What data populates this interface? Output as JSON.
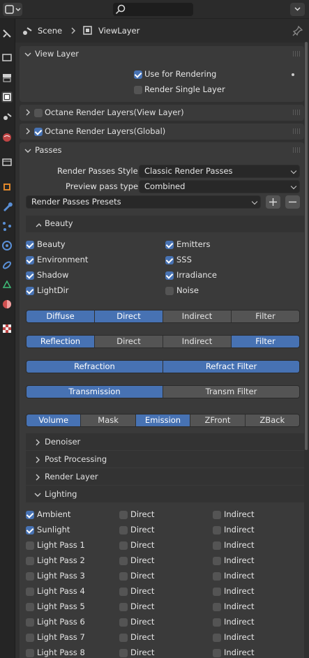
{
  "header": {
    "breadcrumb_scene": "Scene",
    "breadcrumb_viewlayer": "ViewLayer"
  },
  "view_layer": {
    "title": "View Layer",
    "use_for_rendering": "Use for Rendering",
    "render_single_layer": "Render Single Layer"
  },
  "octane_view": {
    "title": "Octane Render Layers(View Layer)"
  },
  "octane_global": {
    "title": "Octane Render Layers(Global)"
  },
  "passes": {
    "title": "Passes",
    "style_label": "Render Passes Style",
    "style_value": "Classic Render Passes",
    "preview_label": "Preview pass type",
    "preview_value": "Combined",
    "presets_value": "Render Passes Presets"
  },
  "beauty": {
    "title": "Beauty",
    "items": [
      {
        "label": "Beauty",
        "checked": true
      },
      {
        "label": "Emitters",
        "checked": true
      },
      {
        "label": "Environment",
        "checked": true
      },
      {
        "label": "SSS",
        "checked": true
      },
      {
        "label": "Shadow",
        "checked": true
      },
      {
        "label": "Irradiance",
        "checked": true
      },
      {
        "label": "LightDir",
        "checked": true
      },
      {
        "label": "Noise",
        "checked": false
      }
    ]
  },
  "toggle_rows": [
    [
      {
        "label": "Diffuse",
        "on": true
      },
      {
        "label": "Direct",
        "on": true
      },
      {
        "label": "Indirect",
        "on": false
      },
      {
        "label": "Filter",
        "on": false
      }
    ],
    [
      {
        "label": "Reflection",
        "on": true
      },
      {
        "label": "Direct",
        "on": false
      },
      {
        "label": "Indirect",
        "on": false
      },
      {
        "label": "Filter",
        "on": true
      }
    ],
    [
      {
        "label": "Refraction",
        "on": true
      },
      {
        "label": "Refract Filter",
        "on": true
      }
    ],
    [
      {
        "label": "Transmission",
        "on": true
      },
      {
        "label": "Transm Filter",
        "on": false
      }
    ],
    [
      {
        "label": "Volume",
        "on": true
      },
      {
        "label": "Mask",
        "on": false
      },
      {
        "label": "Emission",
        "on": true
      },
      {
        "label": "ZFront",
        "on": false
      },
      {
        "label": "ZBack",
        "on": false
      }
    ]
  ],
  "subpanels": [
    "Denoiser",
    "Post Processing",
    "Render Layer",
    "Lighting"
  ],
  "lighting": {
    "direct_label": "Direct",
    "indirect_label": "Indirect",
    "rows": [
      {
        "label": "Ambient",
        "checked": true
      },
      {
        "label": "Sunlight",
        "checked": true
      },
      {
        "label": "Light Pass 1",
        "checked": false
      },
      {
        "label": "Light Pass 2",
        "checked": false
      },
      {
        "label": "Light Pass 3",
        "checked": false
      },
      {
        "label": "Light Pass 4",
        "checked": false
      },
      {
        "label": "Light Pass 5",
        "checked": false
      },
      {
        "label": "Light Pass 6",
        "checked": false
      },
      {
        "label": "Light Pass 7",
        "checked": false
      },
      {
        "label": "Light Pass 8",
        "checked": false
      }
    ]
  },
  "colors": {
    "accent": "#4772b3",
    "panel": "#3a3a3a",
    "background": "#303030"
  }
}
